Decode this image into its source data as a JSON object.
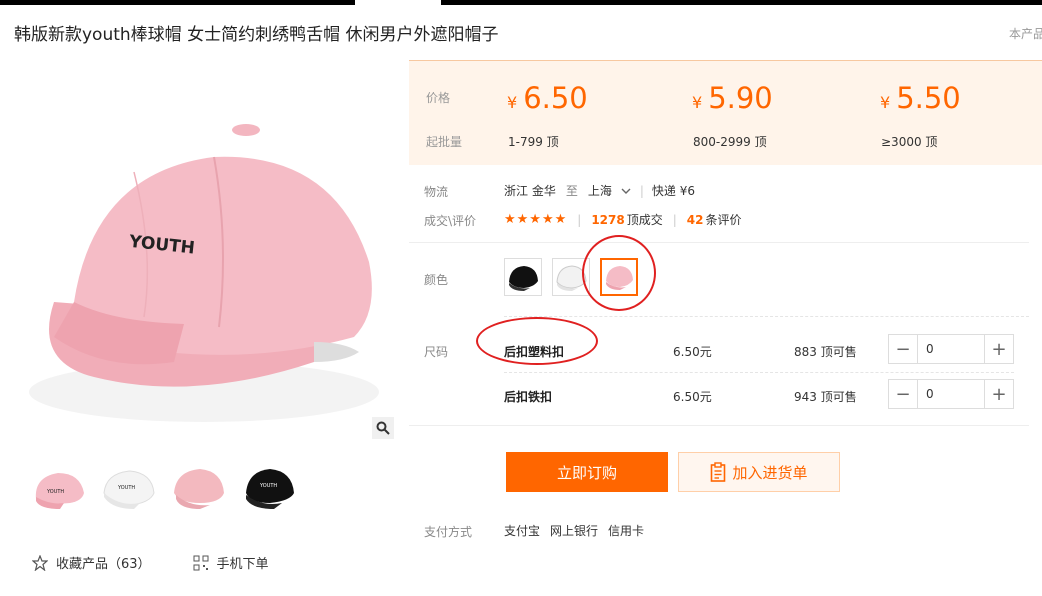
{
  "title": "韩版新款youth棒球帽 女士简约刺绣鸭舌帽 休闲男户外遮阳帽子",
  "side_note": "本产品",
  "image": {
    "text": "YOUTH",
    "cap_color": "#f2b8c0"
  },
  "favorites": {
    "collect_label": "收藏产品（63）",
    "mobile_label": "手机下单"
  },
  "pricing": {
    "price_label": "价格",
    "moq_label": "起批量",
    "currency": "¥",
    "tiers": [
      {
        "price": "6.50",
        "range": "1-799 顶"
      },
      {
        "price": "5.90",
        "range": "800-2999 顶"
      },
      {
        "price": "5.50",
        "range": "≥3000 顶"
      }
    ]
  },
  "logistics": {
    "label": "物流",
    "from": "浙江 金华",
    "to_word": "至",
    "to": "上海",
    "express": "快递 ¥6"
  },
  "reviews": {
    "label": "成交\\评价",
    "stars": "★★★★★",
    "deals_num": "1278",
    "deals_text": "顶成交",
    "reviews_num": "42",
    "reviews_text": "条评价"
  },
  "colors": {
    "label": "颜色",
    "options": [
      "black",
      "white",
      "pink"
    ],
    "selected": "pink"
  },
  "sizes": {
    "label": "尺码",
    "rows": [
      {
        "name": "后扣塑料扣",
        "price": "6.50元",
        "stock": "883 顶可售",
        "qty": "0"
      },
      {
        "name": "后扣铁扣",
        "price": "6.50元",
        "stock": "943 顶可售",
        "qty": "0"
      }
    ]
  },
  "actions": {
    "buy": "立即订购",
    "cart": "加入进货单"
  },
  "payment": {
    "label": "支付方式",
    "methods": [
      "支付宝",
      "网上银行",
      "信用卡"
    ]
  },
  "colors_theme": {
    "accent": "#ff6600",
    "panel": "#fff4ea",
    "annotation": "#e02020"
  }
}
